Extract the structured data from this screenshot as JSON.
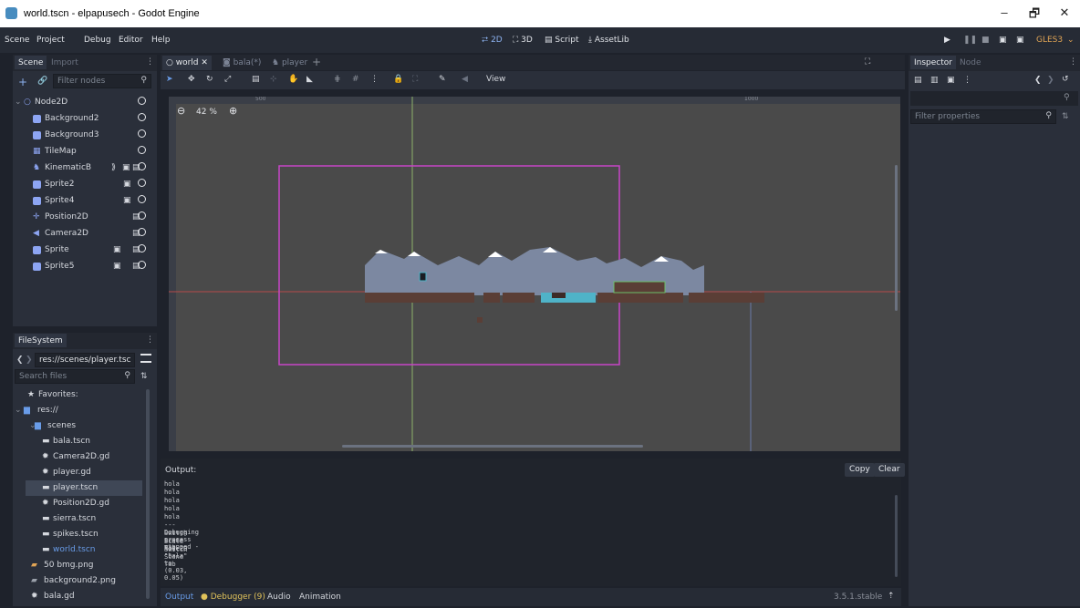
{
  "window": {
    "title": "world.tscn - elpapusech - Godot Engine",
    "min": "–",
    "max": "🗗",
    "close": "✕"
  },
  "menu": [
    "Scene",
    "Project",
    "Debug",
    "Editor",
    "Help"
  ],
  "workspaces": [
    "2D",
    "3D",
    "Script",
    "AssetLib"
  ],
  "renderer": "GLES3",
  "scene_dock": {
    "tabs": [
      "Scene",
      "Import"
    ],
    "filter_placeholder": "Filter nodes",
    "nodes": [
      {
        "label": "Node2D",
        "color": "#8da5f3"
      },
      {
        "label": "Background2",
        "color": "#8da5f3"
      },
      {
        "label": "Background3",
        "color": "#8da5f3"
      },
      {
        "label": "TileMap",
        "color": "#8da5f3"
      },
      {
        "label": "KinematicB",
        "color": "#8da5f3"
      },
      {
        "label": "Sprite2",
        "color": "#8da5f3"
      },
      {
        "label": "Sprite4",
        "color": "#8da5f3"
      },
      {
        "label": "Position2D",
        "color": "#8da5f3"
      },
      {
        "label": "Camera2D",
        "color": "#8da5f3"
      },
      {
        "label": "Sprite",
        "color": "#8da5f3"
      },
      {
        "label": "Sprite5",
        "color": "#8da5f3"
      }
    ]
  },
  "filesystem": {
    "title": "FileSystem",
    "path": "res://scenes/player.tsc",
    "search_placeholder": "Search files",
    "items": [
      {
        "label": "Favorites:",
        "indent": 0
      },
      {
        "label": "res://",
        "indent": 0
      },
      {
        "label": "scenes",
        "indent": 1
      },
      {
        "label": "bala.tscn",
        "indent": 2
      },
      {
        "label": "Camera2D.gd",
        "indent": 2
      },
      {
        "label": "player.gd",
        "indent": 2
      },
      {
        "label": "player.tscn",
        "indent": 2,
        "selected": true
      },
      {
        "label": "Position2D.gd",
        "indent": 2
      },
      {
        "label": "sierra.tscn",
        "indent": 2
      },
      {
        "label": "spikes.tscn",
        "indent": 2
      },
      {
        "label": "world.tscn",
        "indent": 2,
        "accent": true
      },
      {
        "label": "50 bmg.png",
        "indent": 1
      },
      {
        "label": "background2.png",
        "indent": 1
      },
      {
        "label": "bala.gd",
        "indent": 1
      }
    ]
  },
  "editor_tabs": [
    "world",
    "bala(*)",
    "player"
  ],
  "toolbar": {
    "view": "View"
  },
  "viewport": {
    "zoom": "42 %",
    "ruler_marks": [
      "500",
      "1000"
    ]
  },
  "output": {
    "title": "Output:",
    "copy": "Copy",
    "clear": "Clear",
    "lines": [
      "hola",
      "hola",
      "hola",
      "hola",
      "hola",
      "--- Debugging process stopped ---",
      "Switch Scene Tab",
      "Scale Node2D \"bala\" to (0.03, 0.05)",
      "Switch Scene Tab"
    ]
  },
  "bottom": {
    "tabs": [
      "Output",
      "Debugger (9)",
      "Audio",
      "Animation"
    ],
    "version": "3.5.1.stable"
  },
  "inspector": {
    "tabs": [
      "Inspector",
      "Node"
    ],
    "filter_placeholder": "Filter properties"
  },
  "colors": {
    "accent": "#699ce8",
    "selection": "#3f4756",
    "camera": "#c845c8"
  }
}
